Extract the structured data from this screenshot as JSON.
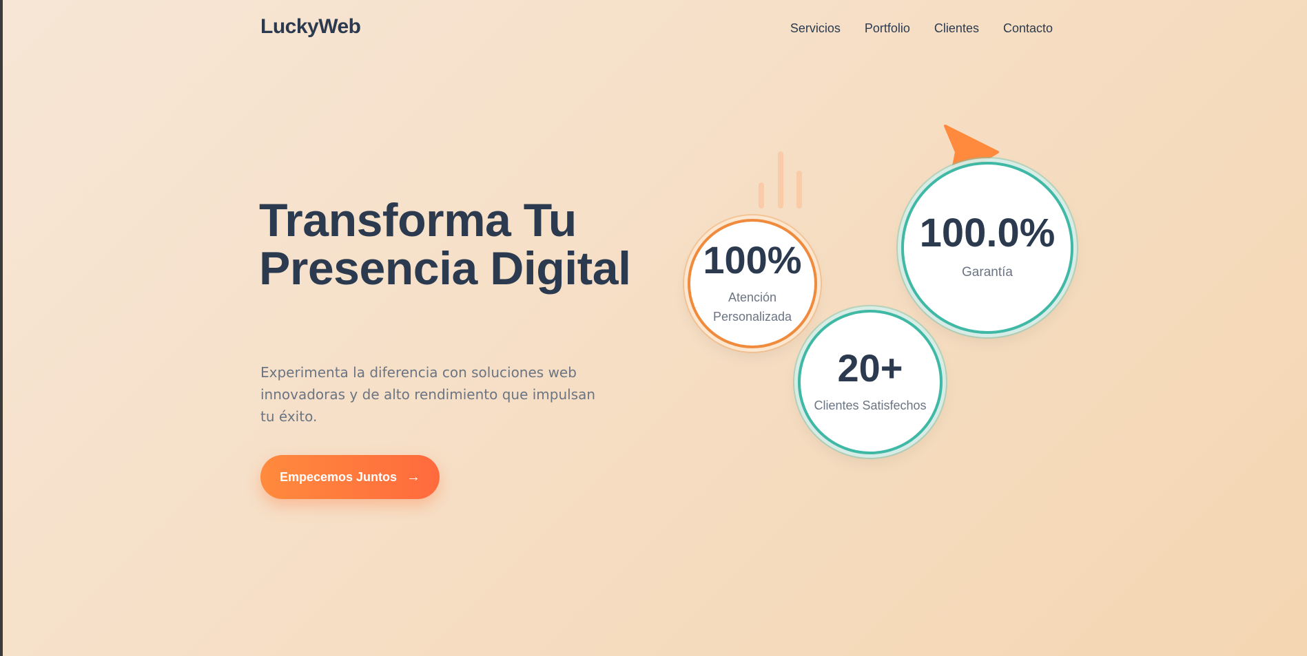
{
  "brand": {
    "logo": "LuckyWeb"
  },
  "nav": {
    "items": [
      "Servicios",
      "Portfolio",
      "Clientes",
      "Contacto"
    ]
  },
  "hero": {
    "title": "Transforma Tu Presencia Digital",
    "subtitle": "Experimenta la diferencia con soluciones web innovadoras y de alto rendimiento que impulsan tu éxito.",
    "cta_label": "Empecemos Juntos",
    "cta_icon": "arrow-right-icon"
  },
  "stats": [
    {
      "value": "100%",
      "label": "Atención Personalizada",
      "color": "#f08a3c"
    },
    {
      "value": "100.0%",
      "label": "Garantía",
      "color": "#3fb9a5"
    },
    {
      "value": "20+",
      "label": "Clientes Satisfechos",
      "color": "#3fb9a5"
    }
  ],
  "colors": {
    "text": "#2b3a4e",
    "muted": "#6b7482",
    "accent_orange": "#ff7a3d",
    "accent_teal": "#3fb9a5"
  },
  "decor": {
    "play_icon": "play-triangle-icon",
    "bars_icon": "bars-decoration-icon"
  }
}
